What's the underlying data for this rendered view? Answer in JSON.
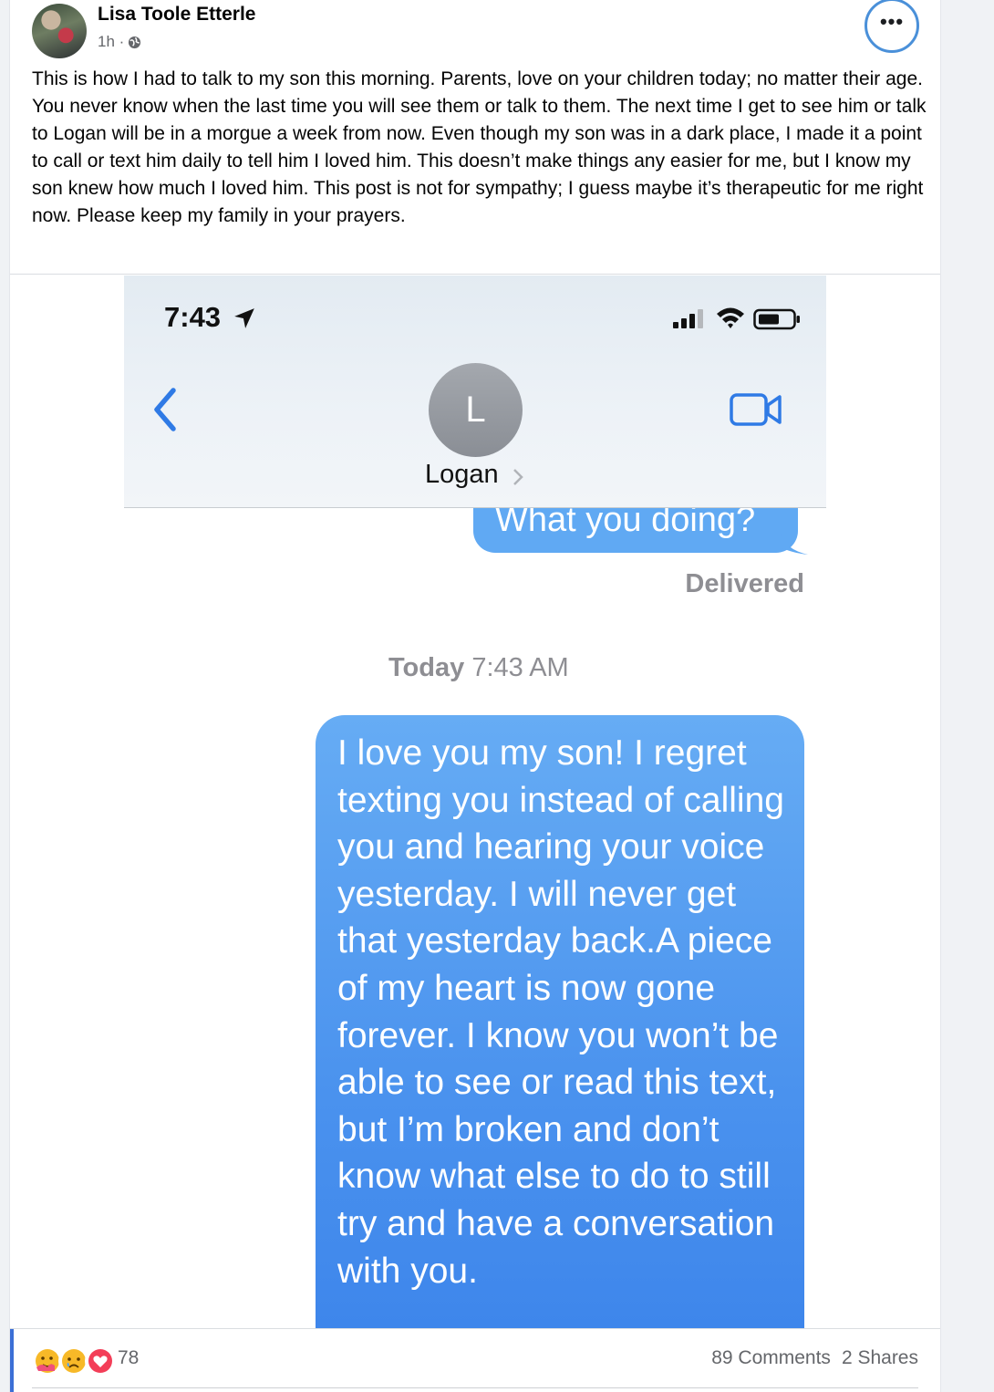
{
  "post": {
    "author": "Lisa Toole Etterle",
    "time": "1h ·",
    "privacy_icon": "globe-icon",
    "more_options_icon": "more-horizontal-icon",
    "more_label": "•••",
    "text": "This is how I had to talk to my son this morning. Parents, love on your children today; no matter their age. You never know when the last time you will see them or talk to them. The next time I get to see him or talk to Logan will be in a morgue a week from now. Even  though my son was in a dark place, I made it a point to call or text him daily to tell him I loved him. This doesn’t make things any easier for me, but I know my son knew how much I loved him. This post is not for sympathy; I guess maybe it’s therapeutic for me right now. Please keep my family in your prayers."
  },
  "screenshot": {
    "status_time": "7:43",
    "contact_initial": "L",
    "contact_name": "Logan",
    "icons": [
      "location-arrow-icon",
      "signal-icon",
      "wifi-icon",
      "battery-icon",
      "back-chevron-icon",
      "video-call-icon"
    ],
    "partial_message": "What you doing?",
    "delivered_label": "Delivered",
    "timestamp_day": "Today",
    "timestamp_time": "7:43 AM",
    "main_message": "I love you my son! I regret texting you instead of calling you and hearing your voice yesterday. I will never get that yesterday back.A piece of my heart is now gone forever.  I know you won’t be able to see or read this text, but I’m broken and don’t know what else to do to still try and have a conversation with you.",
    "colors": {
      "bubble": "#4a92ee",
      "header_bg": "#e3ebf2",
      "ios_blue": "#2f7ae5"
    }
  },
  "footer": {
    "reaction_icons": [
      "care-reaction-icon",
      "sad-reaction-icon",
      "love-reaction-icon"
    ],
    "reaction_count": "78",
    "comments": "89 Comments",
    "shares": "2 Shares"
  }
}
